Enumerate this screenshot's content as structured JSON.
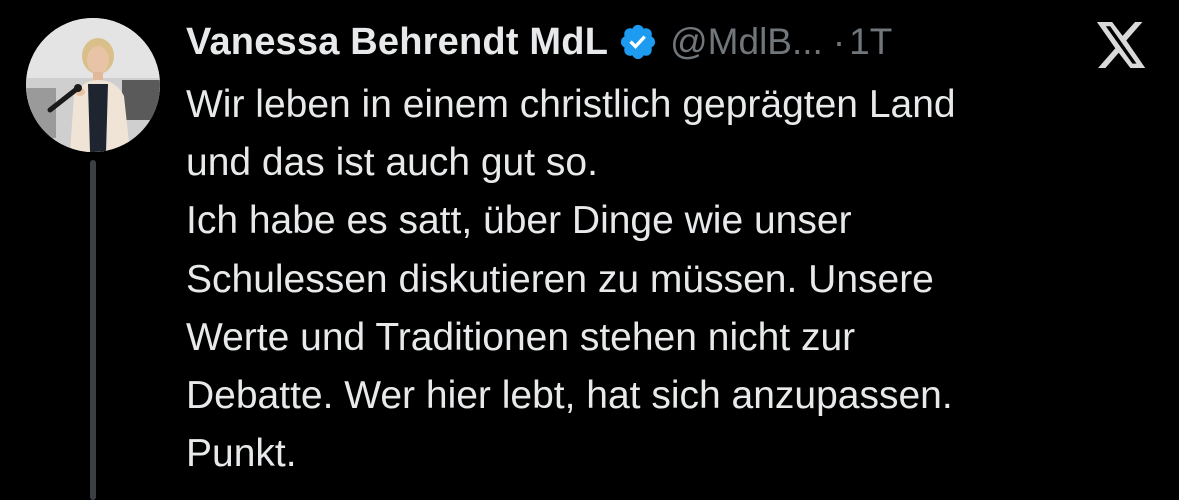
{
  "tweet": {
    "author_name": "Vanessa Behrendt MdL",
    "handle": "@MdlB...",
    "separator": "·",
    "time": "1T",
    "lines": [
      "Wir leben in einem christlich geprägten Land",
      "und das ist auch gut so.",
      "Ich habe es satt, über Dinge wie unser",
      "Schulessen diskutieren zu müssen. Unsere",
      "Werte und Traditionen stehen nicht zur",
      "Debatte. Wer hier lebt, hat sich anzupassen.",
      "Punkt."
    ]
  },
  "icons": {
    "verified": "verified-badge-icon",
    "platform": "x-logo-icon",
    "avatar": "profile-photo"
  },
  "colors": {
    "background": "#000000",
    "text": "#e7e9ea",
    "secondary_text": "#71767b",
    "verified_blue": "#1d9bf0",
    "thread_line": "#3a3f44"
  }
}
